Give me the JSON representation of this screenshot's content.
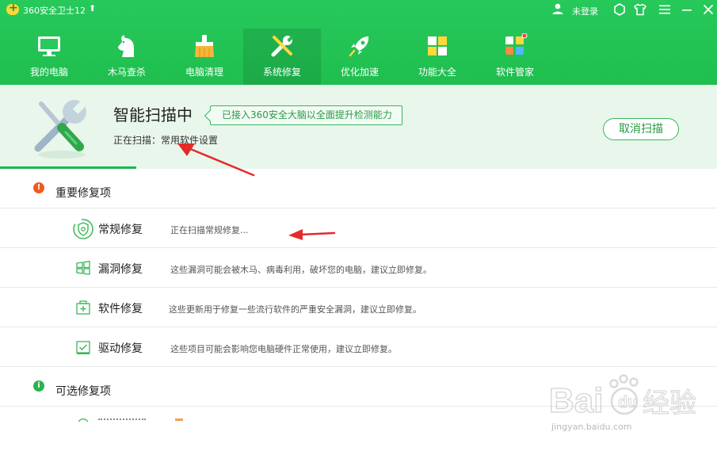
{
  "titlebar": {
    "app_title": "360安全卫士12",
    "upgrade_icon": "arrow-up-icon",
    "login_label": "未登录"
  },
  "nav": {
    "items": [
      {
        "label": "我的电脑",
        "icon": "monitor-icon"
      },
      {
        "label": "木马查杀",
        "icon": "horse-icon"
      },
      {
        "label": "电脑清理",
        "icon": "broom-icon"
      },
      {
        "label": "系统修复",
        "icon": "wrench-icon"
      },
      {
        "label": "优化加速",
        "icon": "rocket-icon"
      },
      {
        "label": "功能大全",
        "icon": "grid-icon"
      },
      {
        "label": "软件管家",
        "icon": "app-store-icon"
      }
    ],
    "active_index": 3
  },
  "scan": {
    "title": "智能扫描中",
    "badge": "已接入360安全大脑以全面提升检测能力",
    "status_text": "正在扫描：常用软件设置",
    "cancel_label": "取消扫描",
    "progress_fraction": 0.19
  },
  "sections": {
    "important": {
      "label": "重要修复项",
      "items": [
        {
          "name": "常规修复",
          "desc": "正在扫描常规修复..."
        },
        {
          "name": "漏洞修复",
          "desc": "这些漏洞可能会被木马、病毒利用，破坏您的电脑，建议立即修复。"
        },
        {
          "name": "软件修复",
          "desc": "这些更新用于修复一些流行软件的严重安全漏洞，建议立即修复。"
        },
        {
          "name": "驱动修复",
          "desc": "这些项目可能会影响您电脑硬件正常使用，建议立即修复。"
        }
      ]
    },
    "optional": {
      "label": "可选修复项"
    }
  },
  "watermark": {
    "logo_text": "Baidu经验",
    "caption": "jingyan.baidu.com"
  },
  "colors": {
    "brand_green": "#1fbe4f",
    "important_orange": "#f05a1e",
    "optional_green": "#27b44a",
    "annotation_red": "#e52a2a"
  }
}
